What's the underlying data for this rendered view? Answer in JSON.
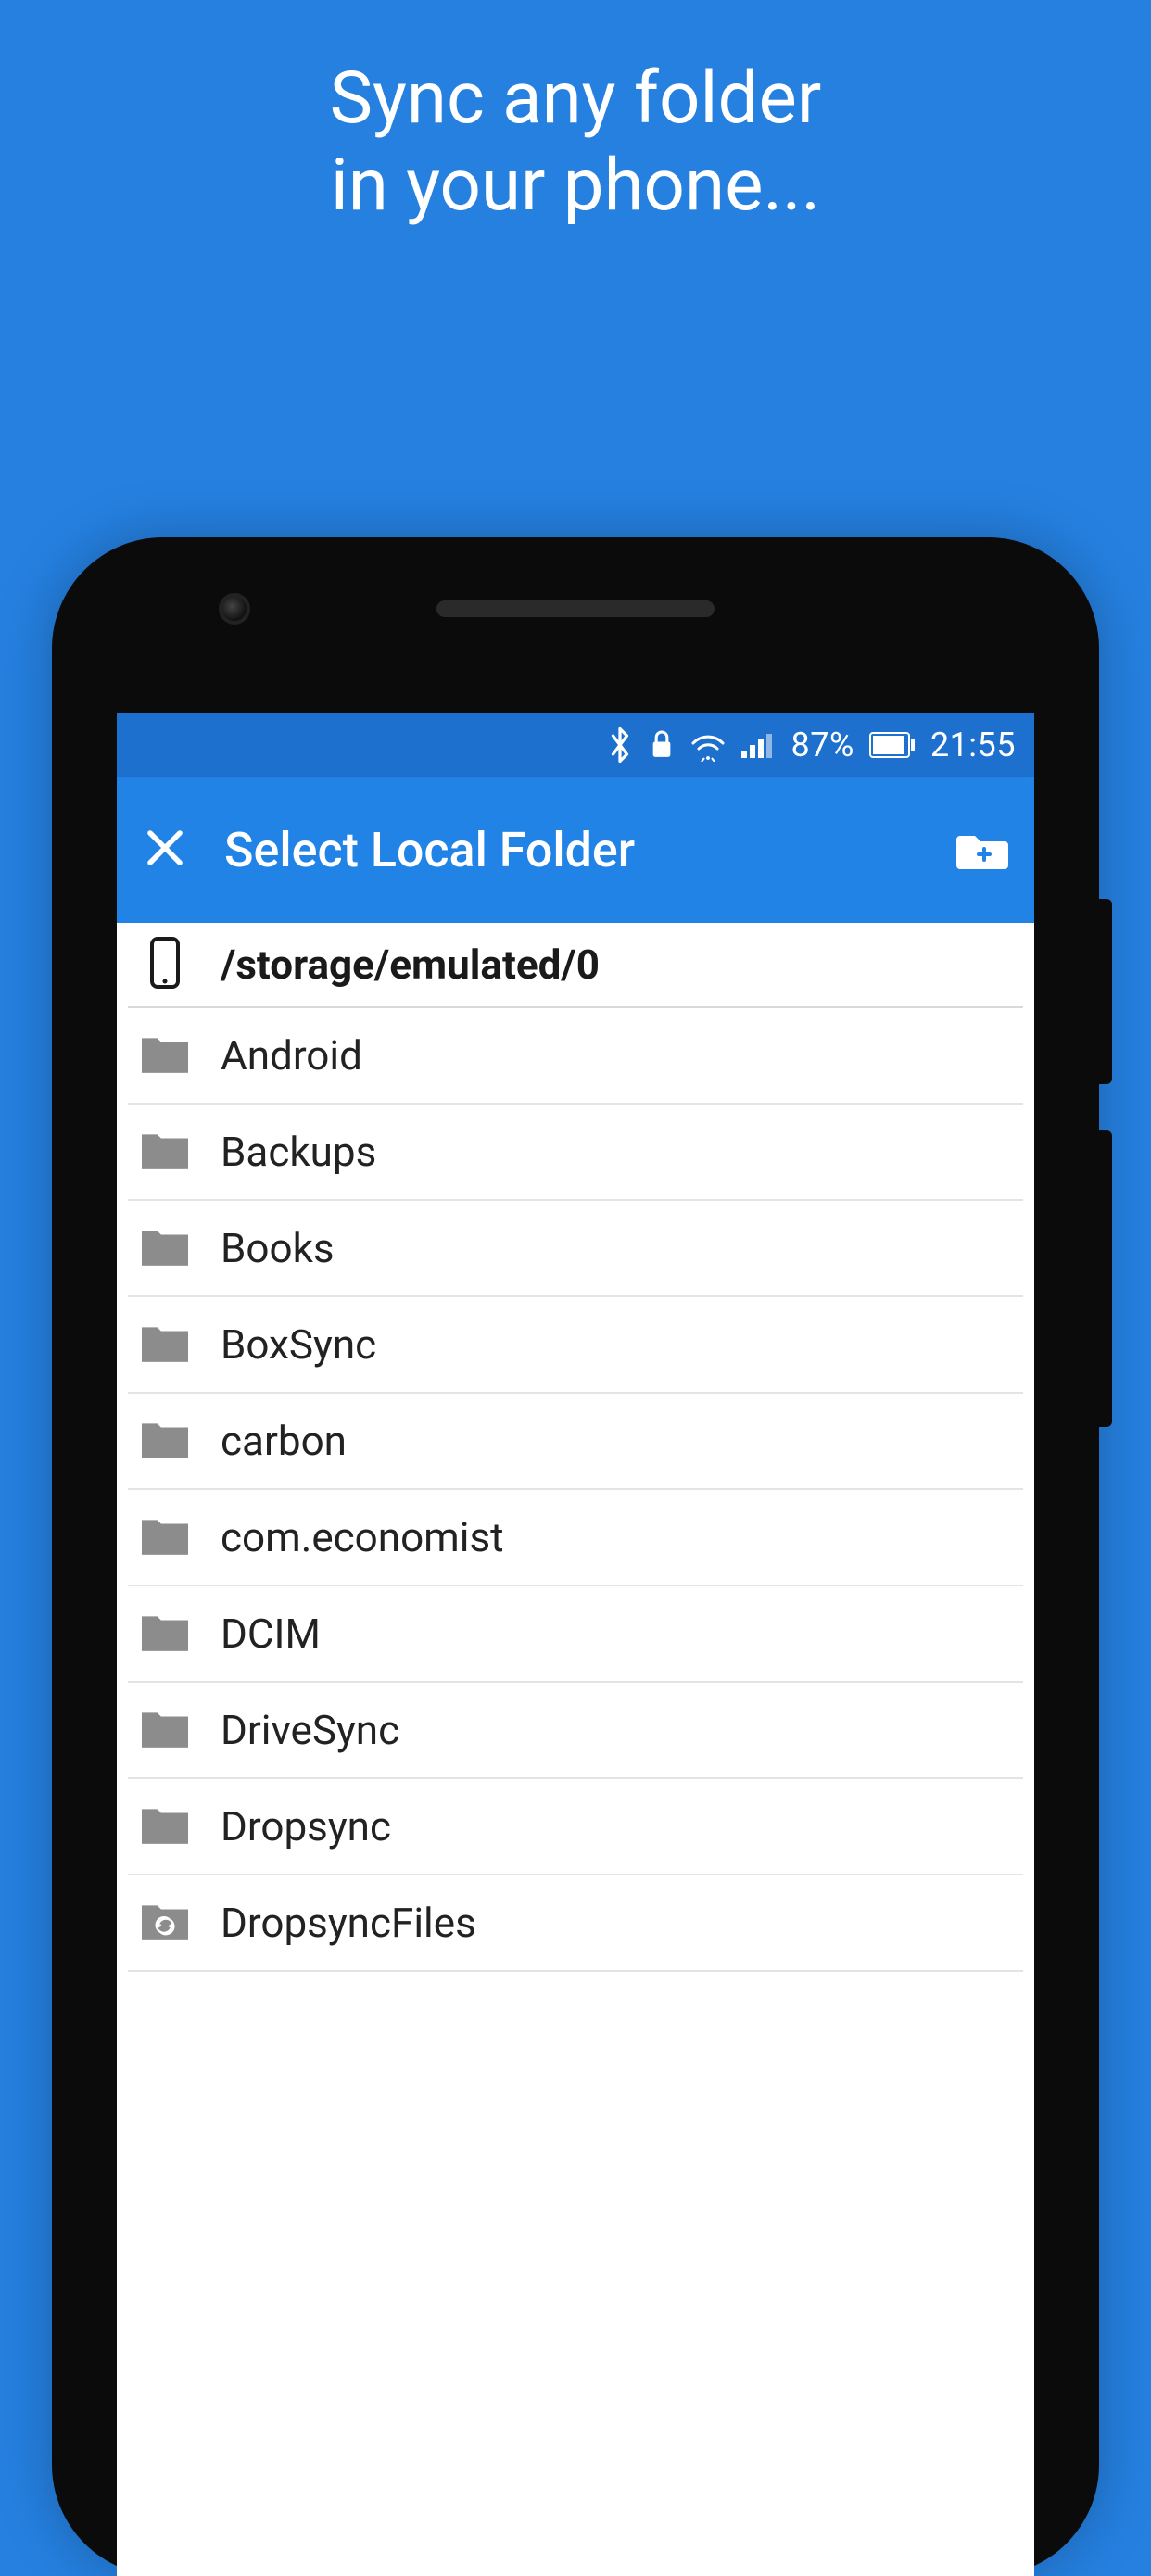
{
  "hero": {
    "line1": "Sync any folder",
    "line2": "in your phone..."
  },
  "statusbar": {
    "battery_percent": "87%",
    "clock": "21:55"
  },
  "appbar": {
    "title": "Select Local Folder"
  },
  "path": "/storage/emulated/0",
  "folders": [
    {
      "name": "Android",
      "synced": false
    },
    {
      "name": "Backups",
      "synced": false
    },
    {
      "name": "Books",
      "synced": false
    },
    {
      "name": "BoxSync",
      "synced": false
    },
    {
      "name": "carbon",
      "synced": false
    },
    {
      "name": "com.economist",
      "synced": false
    },
    {
      "name": "DCIM",
      "synced": false
    },
    {
      "name": "DriveSync",
      "synced": false
    },
    {
      "name": "Dropsync",
      "synced": false
    },
    {
      "name": "DropsyncFiles",
      "synced": true
    }
  ],
  "colors": {
    "background": "#2580E0",
    "statusbar": "#1E70CE",
    "appbar": "#2283E7",
    "folder_icon": "#8C8C8C"
  }
}
